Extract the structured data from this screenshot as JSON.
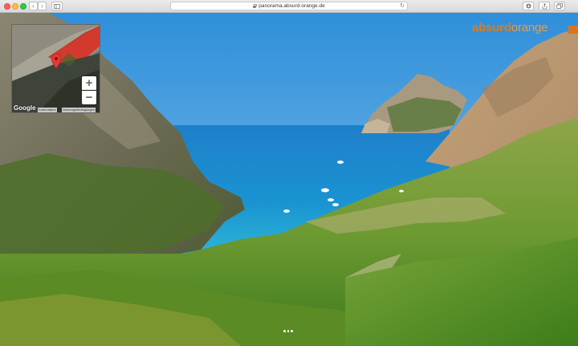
{
  "browser": {
    "url": "panorama.absurd-orange.de",
    "back_glyph": "‹",
    "forward_glyph": "›",
    "reload_glyph": "↻",
    "icons": [
      "sidebar-icon",
      "lock-icon",
      "reload-icon",
      "download-icon",
      "share-icon",
      "tabs-icon"
    ]
  },
  "logo": {
    "part1": "absurd",
    "part2": "orange",
    "color": "#e07a1c"
  },
  "map": {
    "zoom_in": "+",
    "zoom_out": "−",
    "provider": "Google",
    "attribution1": "Kartendaten",
    "attribution2": "Nutzungsbedingungen",
    "pin_color": "#e53935"
  },
  "pano": {
    "sky_color": "#3e9ad8",
    "sea_color": "#1a86c9",
    "boats_count": 6,
    "pager_dots": 3
  }
}
